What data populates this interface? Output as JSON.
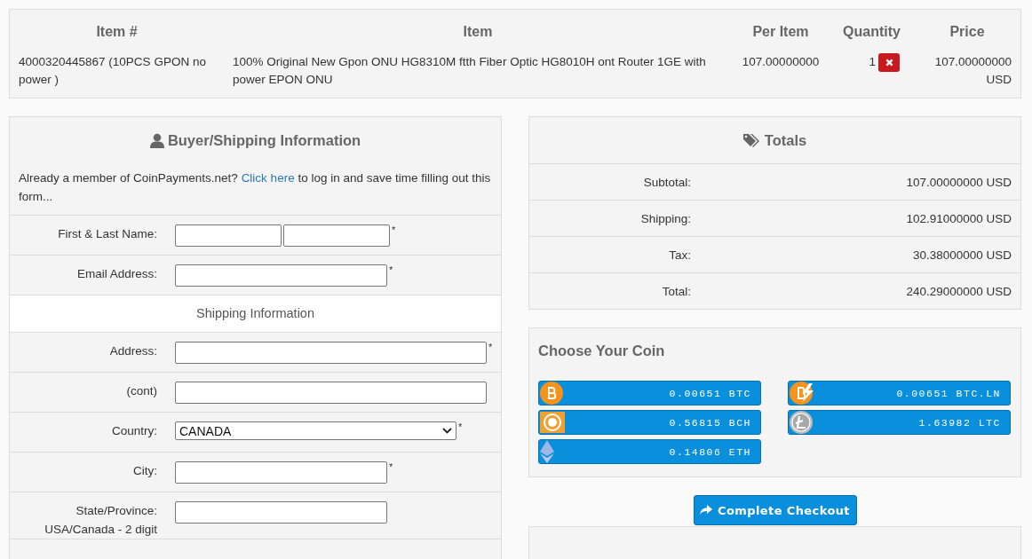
{
  "order_table": {
    "columns": [
      "Item #",
      "Item",
      "Per Item",
      "Quantity",
      "Price"
    ],
    "rows": [
      {
        "item_number": "4000320445867 (10PCS GPON no power )",
        "item": "100% Original New Gpon ONU HG8310M ftth Fiber Optic HG8010H ont Router 1GE with power EPON ONU",
        "per_item": "107.00000000",
        "quantity": "1",
        "price": "107.00000000 USD"
      }
    ]
  },
  "buyer_panel": {
    "title": "Buyer/Shipping Information",
    "intro": {
      "before": "Already a member of CoinPayments.net? ",
      "link": "Click here",
      "after": " to log in and save time filling out this form..."
    },
    "rows": [
      {
        "kind": "inputs",
        "label": "First & Last Name:",
        "inputs": [
          {
            "kind": "short"
          },
          {
            "kind": "short"
          }
        ],
        "required": "*"
      },
      {
        "kind": "inputs",
        "label": "Email Address:",
        "inputs": [
          {
            "kind": "medium"
          }
        ],
        "required": "*"
      },
      {
        "kind": "section",
        "label": "Shipping Information"
      },
      {
        "kind": "inputs",
        "label": "Address:",
        "inputs": [
          {
            "kind": "long"
          }
        ],
        "required": "*"
      },
      {
        "kind": "inputs",
        "label": "(cont)",
        "inputs": [
          {
            "kind": "long"
          }
        ]
      },
      {
        "kind": "select",
        "label": "Country:",
        "value": "CANADA",
        "required": "*"
      },
      {
        "kind": "inputs",
        "label": "City:",
        "inputs": [
          {
            "kind": "medium"
          }
        ],
        "required": "*"
      },
      {
        "kind": "inputs",
        "label": "State/Province:",
        "note": "USA/Canada - 2 digit",
        "inputs": [
          {
            "kind": "medium"
          }
        ]
      }
    ]
  },
  "totals_panel": {
    "title": "Totals",
    "rows": [
      {
        "label": "Subtotal:",
        "value": "107.00000000 USD"
      },
      {
        "label": "Shipping:",
        "value": "102.91000000 USD"
      },
      {
        "label": "Tax:",
        "value": "30.38000000 USD"
      },
      {
        "label": "Total:",
        "value": "240.29000000 USD"
      }
    ]
  },
  "coin_panel": {
    "title": "Choose Your Coin",
    "coins": [
      {
        "kind": "btc",
        "amount": "0.00651 BTC"
      },
      {
        "kind": "lightning",
        "amount": "0.00651 BTC.LN"
      },
      {
        "kind": "bch",
        "amount": "0.56815 BCH"
      },
      {
        "kind": "ltc",
        "amount": "1.63982 LTC"
      },
      {
        "kind": "eth",
        "amount": "0.14806 ETH"
      }
    ]
  },
  "checkout_button": "Complete Checkout"
}
